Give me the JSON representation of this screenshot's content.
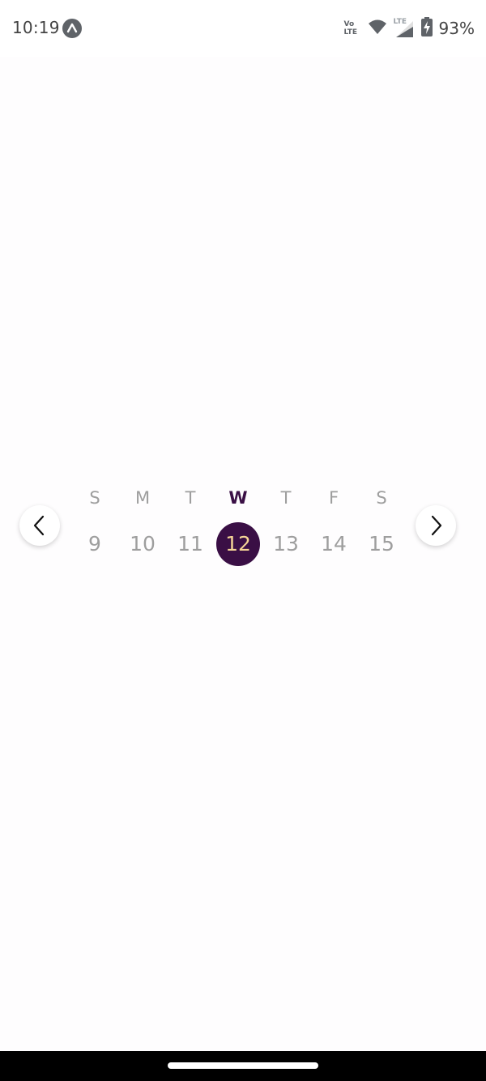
{
  "status_bar": {
    "time": "10:19",
    "volte_line1": "Vo",
    "volte_line2": "LTE",
    "network_tag": "LTE",
    "battery_percent": "93%",
    "icons": [
      "app-notification-icon",
      "volte-icon",
      "wifi-icon",
      "cell-signal-icon",
      "battery-charging-icon"
    ]
  },
  "week_strip": {
    "prev_icon": "chevron-left-icon",
    "next_icon": "chevron-right-icon",
    "selected_color": "#3a0f45",
    "selected_text_color": "#f5d596",
    "days": [
      {
        "letter": "S",
        "number": "9",
        "selected": false
      },
      {
        "letter": "M",
        "number": "10",
        "selected": false
      },
      {
        "letter": "T",
        "number": "11",
        "selected": false
      },
      {
        "letter": "W",
        "number": "12",
        "selected": true
      },
      {
        "letter": "T",
        "number": "13",
        "selected": false
      },
      {
        "letter": "F",
        "number": "14",
        "selected": false
      },
      {
        "letter": "S",
        "number": "15",
        "selected": false
      }
    ]
  }
}
